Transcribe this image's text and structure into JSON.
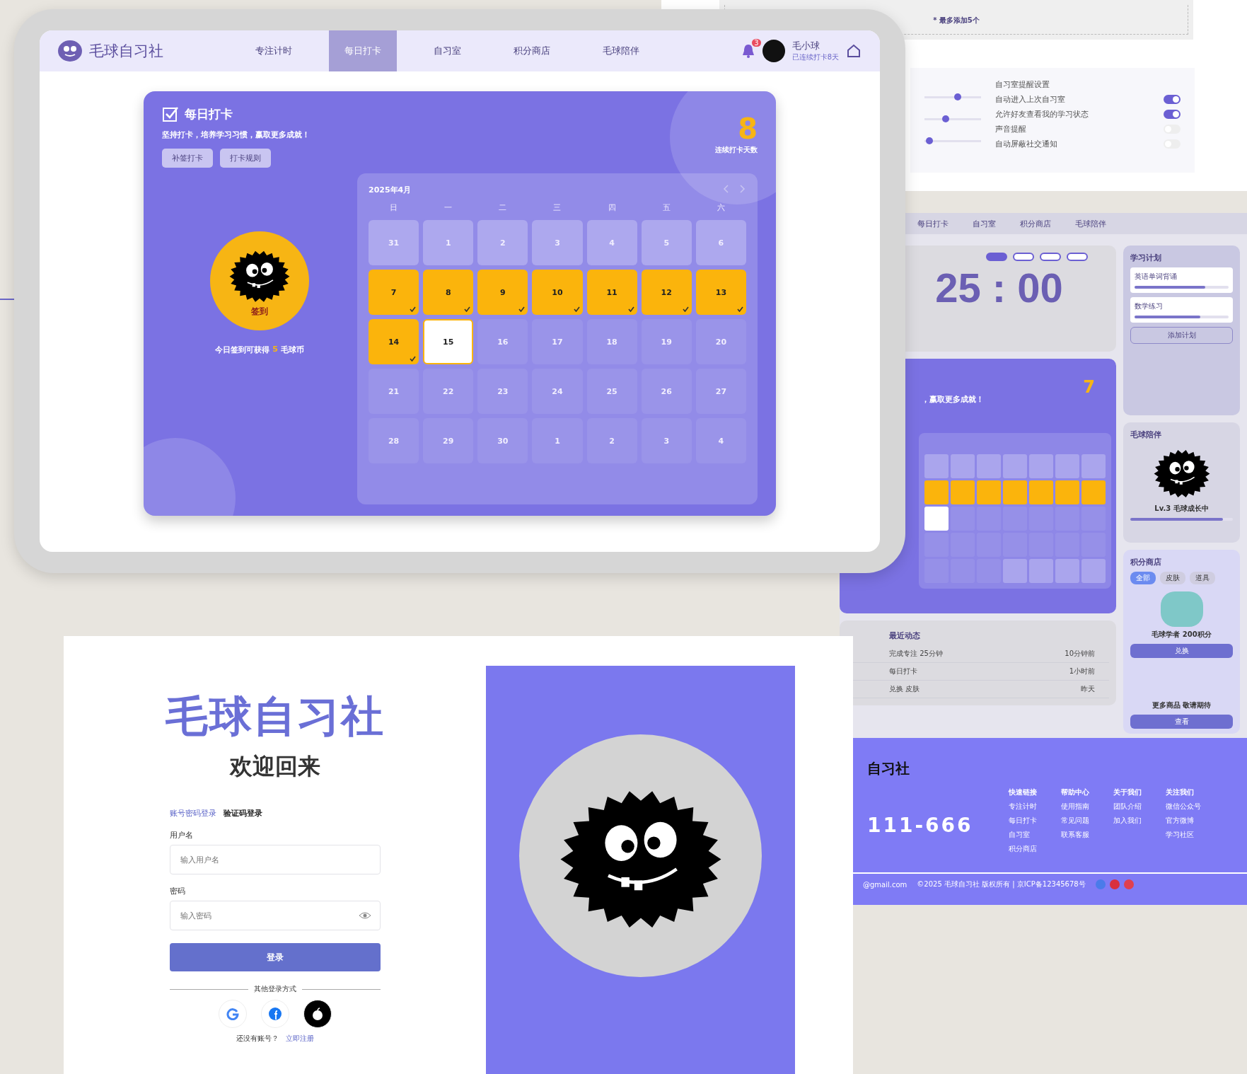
{
  "settings": {
    "note": "* 最多添加5个",
    "sliders": [
      {
        "level": 0.6
      },
      {
        "level": 0.35
      },
      {
        "level": 0.03
      }
    ],
    "heading": "自习室提醒设置",
    "options": [
      {
        "label": "自动进入上次自习室",
        "on": true
      },
      {
        "label": "允许好友查看我的学习状态",
        "on": true
      },
      {
        "label": "声音提醒",
        "on": false
      },
      {
        "label": "自动屏蔽社交通知",
        "on": false
      }
    ]
  },
  "focus_app": {
    "nav": [
      "每日打卡",
      "自习室",
      "积分商店",
      "毛球陪伴"
    ],
    "timer": "25 : 00",
    "modes": [
      {
        "selected": true
      },
      {
        "selected": false
      },
      {
        "selected": false
      },
      {
        "selected": false
      }
    ],
    "checkin": {
      "subtitle": "，赢取更多成就！",
      "streak": "7",
      "cells": [
        {
          "kind": "outside"
        },
        {
          "kind": "outside"
        },
        {
          "kind": "outside"
        },
        {
          "kind": "outside"
        },
        {
          "kind": "outside"
        },
        {
          "kind": "outside"
        },
        {
          "kind": "outside"
        },
        {
          "kind": "checked"
        },
        {
          "kind": "checked"
        },
        {
          "kind": "checked"
        },
        {
          "kind": "checked"
        },
        {
          "kind": "checked"
        },
        {
          "kind": "checked"
        },
        {
          "kind": "checked"
        },
        {
          "kind": "today"
        },
        {
          "kind": "plain"
        },
        {
          "kind": "plain"
        },
        {
          "kind": "plain"
        },
        {
          "kind": "plain"
        },
        {
          "kind": "plain"
        },
        {
          "kind": "plain"
        },
        {
          "kind": "plain"
        },
        {
          "kind": "plain"
        },
        {
          "kind": "plain"
        },
        {
          "kind": "plain"
        },
        {
          "kind": "plain"
        },
        {
          "kind": "plain"
        },
        {
          "kind": "plain"
        },
        {
          "kind": "plain"
        },
        {
          "kind": "plain"
        },
        {
          "kind": "plain"
        },
        {
          "kind": "outside"
        },
        {
          "kind": "outside"
        },
        {
          "kind": "outside"
        },
        {
          "kind": "outside"
        }
      ]
    },
    "recent": {
      "title": "最近动态",
      "items": [
        {
          "title": "完成专注 25分钟",
          "time": "10分钟前"
        },
        {
          "title": "每日打卡",
          "time": "1小时前"
        },
        {
          "title": "兑换 皮肤",
          "time": "昨天"
        }
      ]
    },
    "plan": {
      "title": "学习计划",
      "tasks": [
        {
          "name": "英语单词背诵",
          "level": 0.75
        },
        {
          "name": "数学练习",
          "level": 0.7
        }
      ],
      "button": "添加计划"
    },
    "companion": {
      "title": "毛球陪伴",
      "level_text": "Lv.3 毛球成长中",
      "level": 0.9
    },
    "shop": {
      "title": "积分商店",
      "tabs": [
        {
          "label": "全部",
          "selected": true
        },
        {
          "label": "皮肤",
          "selected": false
        },
        {
          "label": "道具",
          "selected": false
        }
      ],
      "item": "毛球学者 200积分",
      "buy": "兑换",
      "more": "更多商品 敬请期待",
      "more_button": "查看"
    }
  },
  "footer": {
    "brand": "自习社",
    "phone": "111-666",
    "columns": [
      {
        "title": "快速链接",
        "links": [
          "专注计时",
          "每日打卡",
          "自习室",
          "积分商店"
        ]
      },
      {
        "title": "帮助中心",
        "links": [
          "使用指南",
          "常见问题",
          "联系客服"
        ]
      },
      {
        "title": "关于我们",
        "links": [
          "团队介绍",
          "加入我们"
        ]
      },
      {
        "title": "关注我们",
        "links": [
          "微信公众号",
          "官方微博",
          "学习社区"
        ]
      }
    ],
    "email": "@gmail.com",
    "copyright": "©2025 毛球自习社 版权所有 | 京ICP备12345678号"
  },
  "tablet": {
    "brand": "毛球自习社",
    "nav": [
      {
        "label": "专注计时",
        "selected": false
      },
      {
        "label": "每日打卡",
        "selected": true
      },
      {
        "label": "自习室",
        "selected": false
      },
      {
        "label": "积分商店",
        "selected": false
      },
      {
        "label": "毛球陪伴",
        "selected": false
      }
    ],
    "notification_count": "3",
    "user": {
      "name": "毛小球",
      "status": "已连续打卡8天"
    },
    "checkin": {
      "title": "每日打卡",
      "subtitle": "坚持打卡，培养学习习惯，赢取更多成就！",
      "buttons": [
        "补签打卡",
        "打卡规则"
      ],
      "streak": "8",
      "streak_label": "连续打卡天数",
      "mascot_label": "签到",
      "reward": {
        "prefix": "今日签到可获得",
        "amount": "5",
        "suffix": "毛球币"
      },
      "calendar": {
        "month": "2025年4月",
        "weekdays": [
          "日",
          "一",
          "二",
          "三",
          "四",
          "五",
          "六"
        ],
        "days": [
          {
            "label": "31",
            "kind": "outside"
          },
          {
            "label": "1",
            "kind": "outside"
          },
          {
            "label": "2",
            "kind": "outside"
          },
          {
            "label": "3",
            "kind": "outside"
          },
          {
            "label": "4",
            "kind": "outside"
          },
          {
            "label": "5",
            "kind": "outside"
          },
          {
            "label": "6",
            "kind": "outside"
          },
          {
            "label": "7",
            "kind": "checked"
          },
          {
            "label": "8",
            "kind": "checked"
          },
          {
            "label": "9",
            "kind": "checked"
          },
          {
            "label": "10",
            "kind": "checked"
          },
          {
            "label": "11",
            "kind": "checked"
          },
          {
            "label": "12",
            "kind": "checked"
          },
          {
            "label": "13",
            "kind": "checked"
          },
          {
            "label": "14",
            "kind": "checked"
          },
          {
            "label": "15",
            "kind": "today"
          },
          {
            "label": "16",
            "kind": "plain"
          },
          {
            "label": "17",
            "kind": "plain"
          },
          {
            "label": "18",
            "kind": "plain"
          },
          {
            "label": "19",
            "kind": "plain"
          },
          {
            "label": "20",
            "kind": "plain"
          },
          {
            "label": "21",
            "kind": "plain"
          },
          {
            "label": "22",
            "kind": "plain"
          },
          {
            "label": "23",
            "kind": "plain"
          },
          {
            "label": "24",
            "kind": "plain"
          },
          {
            "label": "25",
            "kind": "plain"
          },
          {
            "label": "26",
            "kind": "plain"
          },
          {
            "label": "27",
            "kind": "plain"
          },
          {
            "label": "28",
            "kind": "plain"
          },
          {
            "label": "29",
            "kind": "plain"
          },
          {
            "label": "30",
            "kind": "plain"
          },
          {
            "label": "1",
            "kind": "plain"
          },
          {
            "label": "2",
            "kind": "plain"
          },
          {
            "label": "3",
            "kind": "plain"
          },
          {
            "label": "4",
            "kind": "plain"
          }
        ]
      }
    }
  },
  "login": {
    "brand": "毛球自习社",
    "welcome": "欢迎回来",
    "tabs": [
      {
        "label": "账号密码登录",
        "selected": true
      },
      {
        "label": "验证码登录",
        "selected": false
      }
    ],
    "username_label": "用户名",
    "username_placeholder": "输入用户名",
    "password_label": "密码",
    "password_placeholder": "输入密码",
    "submit": "登录",
    "other": "其他登录方式",
    "no_account": "还没有账号？",
    "register": "立即注册"
  }
}
